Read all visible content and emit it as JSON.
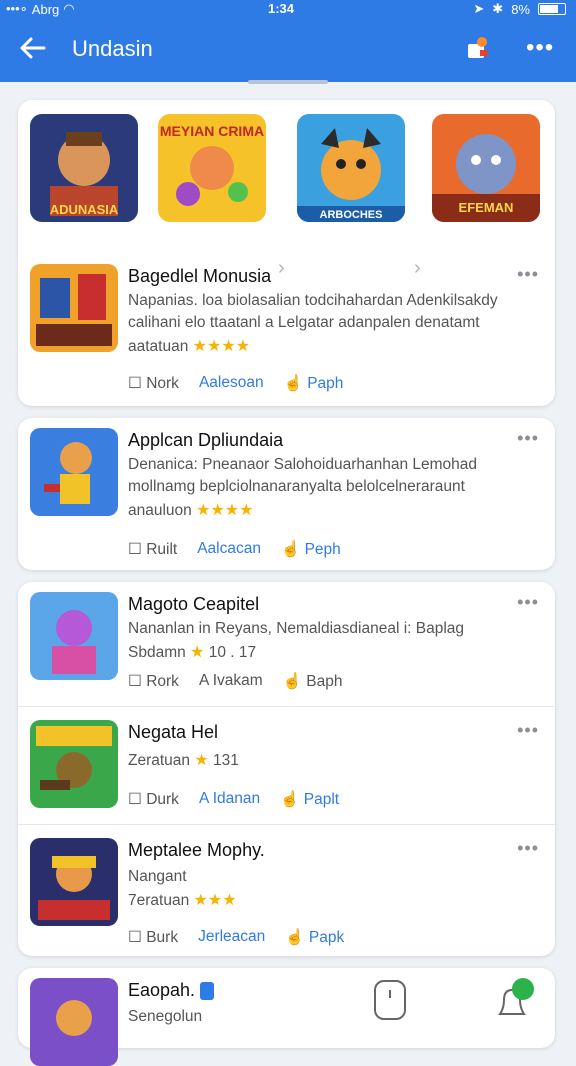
{
  "status": {
    "carrier": "Abrg",
    "time": "1:34",
    "battery": "8%"
  },
  "appbar": {
    "title": "Undasin",
    "back_icon": "back-arrow-icon",
    "cart_icon": "cart-icon",
    "more_icon": "more-icon"
  },
  "featured": [
    {
      "label": "ADUNASIA"
    },
    {
      "label": "MEYIAN CRIMA"
    },
    {
      "label": "ARBOCHES"
    },
    {
      "label": "EFEMAN"
    }
  ],
  "apps": [
    {
      "name": "Bagedlel Monusia",
      "desc": "Napanias. loa biolasalian todcihahardan Adenkilsakdy calihani elo ttaatanl a Lelgatar adanpalen denatamt",
      "meta_prefix": "aatatuan",
      "stars": "★★★★",
      "action1": "Nork",
      "action2": "Aalesoan",
      "action3": "Paph"
    },
    {
      "name": "Applcan Dpliundaia",
      "desc": "Denanica: Pneanaor Salohoiduarhanhan Lemohad mollnamg beplciolnanaranyalta belolcelneraraunt",
      "meta_prefix": "anauluon",
      "stars": "★★★★",
      "action1": "Ruilt",
      "action2": "Aalcacan",
      "action3": "Peph"
    },
    {
      "name": "Magoto Ceapitel",
      "desc": "Nananlan in Reyans, Nemaldiasdianeal i: Baplag",
      "meta_prefix": "Sbdamn",
      "rating": "10 . 17",
      "stars": "★",
      "action1": "Rork",
      "action2": "A Ivakam",
      "action3": "Baph"
    },
    {
      "name": "Negata Hel",
      "meta_prefix": "Zeratuan",
      "rating": "131",
      "stars": "★",
      "action1": "Durk",
      "action2": "A Idanan",
      "action3": "Paplt"
    },
    {
      "name": "Meptalee Mophy.",
      "desc": "Nangant",
      "meta_prefix": "7eratuan",
      "stars": "★★★",
      "action1": "Burk",
      "action2": "Jerleacan",
      "action3": "Papk"
    },
    {
      "name": "Eaopah.",
      "desc": "Senegolun"
    }
  ],
  "colors": {
    "primary": "#2f7be6",
    "star": "#f5b400"
  }
}
